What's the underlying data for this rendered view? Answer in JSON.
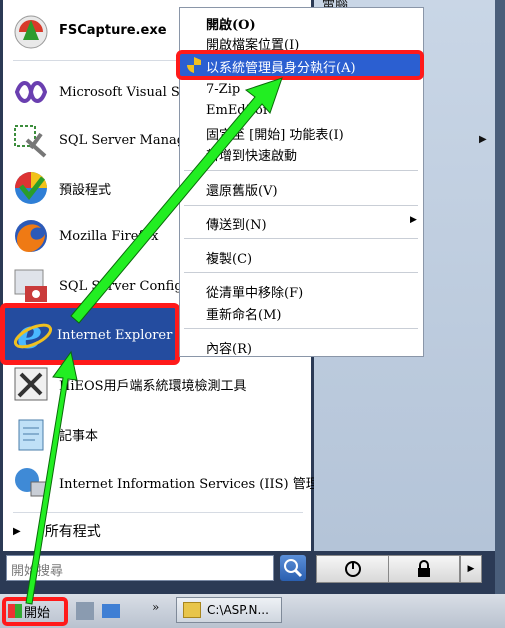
{
  "start_menu": {
    "programs": [
      {
        "label": "FSCapture.exe",
        "icon": "fscapture-icon",
        "bold": true
      },
      {
        "label": "Microsoft Visual Studio",
        "icon": "visual-studio-icon"
      },
      {
        "label": "SQL Server Management Studio",
        "icon": "sql-server-icon"
      },
      {
        "label": "預設程式",
        "icon": "default-programs-icon"
      },
      {
        "label": "Mozilla Firefox",
        "icon": "firefox-icon"
      },
      {
        "label": "SQL Server Configuration Manager",
        "icon": "sql-config-icon"
      },
      {
        "label": "Internet Explorer",
        "icon": "internet-explorer-icon"
      },
      {
        "label": "HiEOS用戶端系統環境檢測工具",
        "icon": "tools-icon"
      },
      {
        "label": "記事本",
        "icon": "notepad-icon"
      },
      {
        "label": "Internet Information Services (IIS) 管理員",
        "icon": "iis-icon"
      }
    ],
    "all_programs": "所有程式",
    "search_placeholder": "開始搜尋",
    "right_pane": {
      "top_item": "電腦"
    }
  },
  "context_menu": {
    "items": {
      "open": "開啟(O)",
      "open_location": "開啟檔案位置(I)",
      "run_as_admin": "以系統管理員身分執行(A)",
      "zip": "7-Zip",
      "emeditor": "EmEditor",
      "pin_start": "固定至 [開始] 功能表(I)",
      "quick_launch": "新增到快速啟動",
      "restore": "還原舊版(V)",
      "send_to": "傳送到(N)",
      "copy": "複製(C)",
      "remove": "從清單中移除(F)",
      "rename": "重新命名(M)",
      "properties": "內容(R)"
    }
  },
  "taskbar": {
    "start_label": "開始",
    "task_label": "C:\\ASP.N..."
  },
  "colors": {
    "highlight": "#2b5fd1",
    "annotation_red": "#ff1a1a",
    "arrow_green": "#22ee22"
  }
}
